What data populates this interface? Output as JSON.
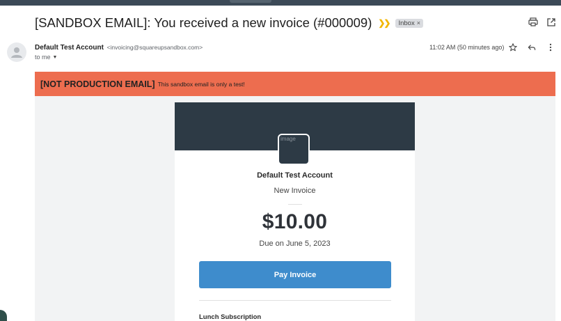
{
  "message": {
    "subject": "[SANDBOX EMAIL]: You received a new invoice (#000009)",
    "label_chip": "Inbox",
    "label_remove": "×",
    "sender_name": "Default Test Account",
    "sender_email": "<invoicing@squareupsandbox.com>",
    "recipient": "to me",
    "timestamp": "11:02 AM (50 minutes ago)"
  },
  "icons": {
    "importance": "label-important-icon",
    "print": "print-icon",
    "new_window": "open-in-new-window-icon",
    "star": "star-icon",
    "reply": "reply-icon",
    "more": "more-vert-icon",
    "avatar": "person-icon",
    "caret": "chevron-down-icon"
  },
  "banner": {
    "strong": "[NOT PRODUCTION EMAIL]",
    "text": "This sandbox email is only a test!",
    "color": "#ed6d4f"
  },
  "invoice": {
    "logo_alt": "image",
    "merchant": "Default Test Account",
    "title": "New Invoice",
    "amount": "$10.00",
    "due": "Due on June 5, 2023",
    "pay_label": "Pay Invoice",
    "first_item": "Lunch Subscription",
    "header_color": "#2d3a45",
    "button_color": "#3e8ccc"
  }
}
